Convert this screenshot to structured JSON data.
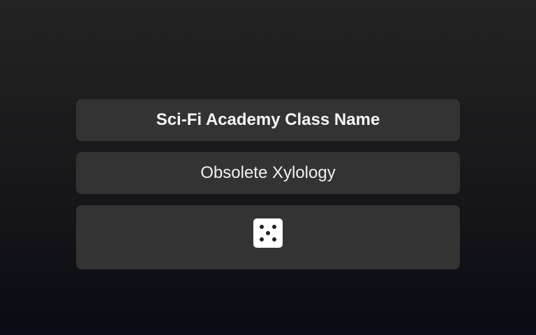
{
  "header": {
    "title": "Sci-Fi Academy Class Name"
  },
  "result": {
    "class_name": "Obsolete Xylology"
  },
  "dice": {
    "icon": "dice-five-icon",
    "face_value": 5,
    "pip_color": "#222222",
    "face_color": "#ffffff"
  },
  "colors": {
    "panel": "#333333",
    "text": "#f2f2f2"
  }
}
